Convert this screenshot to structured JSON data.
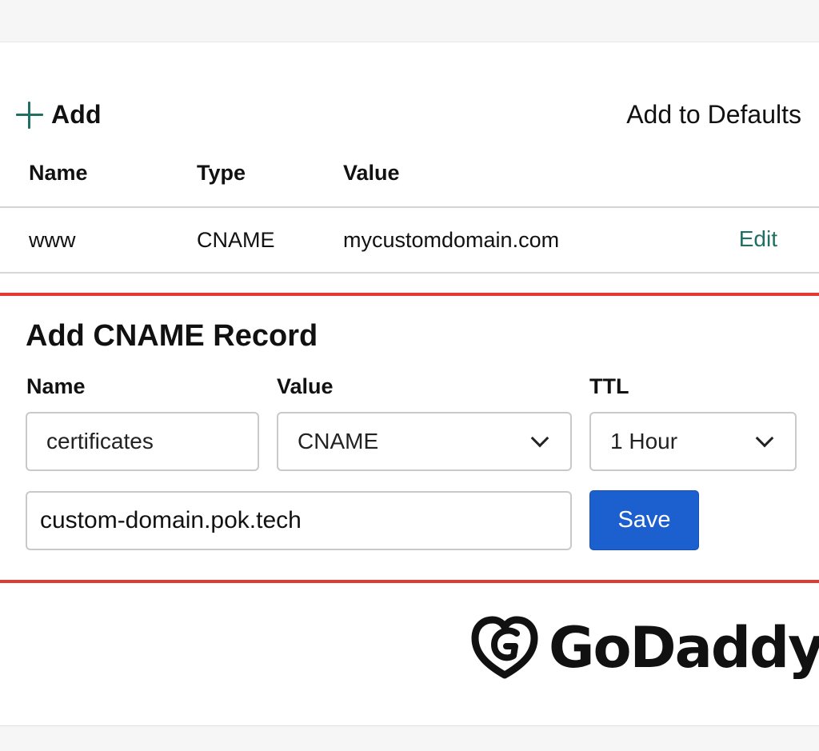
{
  "toolbar": {
    "add_label": "Add",
    "add_to_defaults_label": "Add to Defaults"
  },
  "table": {
    "columns": [
      "Name",
      "Type",
      "Value"
    ],
    "rows": [
      {
        "name": "www",
        "type": "CNAME",
        "value": "mycustomdomain.com",
        "action": "Edit"
      }
    ]
  },
  "form": {
    "title": "Add CNAME Record",
    "name_label": "Name",
    "value_label": "Value",
    "ttl_label": "TTL",
    "name_value": "certificates",
    "type_value": "CNAME",
    "ttl_value": "1 Hour",
    "target_value": "custom-domain.pok.tech",
    "save_label": "Save"
  },
  "logo": {
    "text": "GoDaddy"
  },
  "colors": {
    "accent_green": "#1f6f63",
    "highlight_red": "#e03a32",
    "save_blue": "#1c5fce"
  },
  "icons": [
    "plus-icon",
    "chevron-down-icon",
    "godaddy-logo-icon"
  ]
}
